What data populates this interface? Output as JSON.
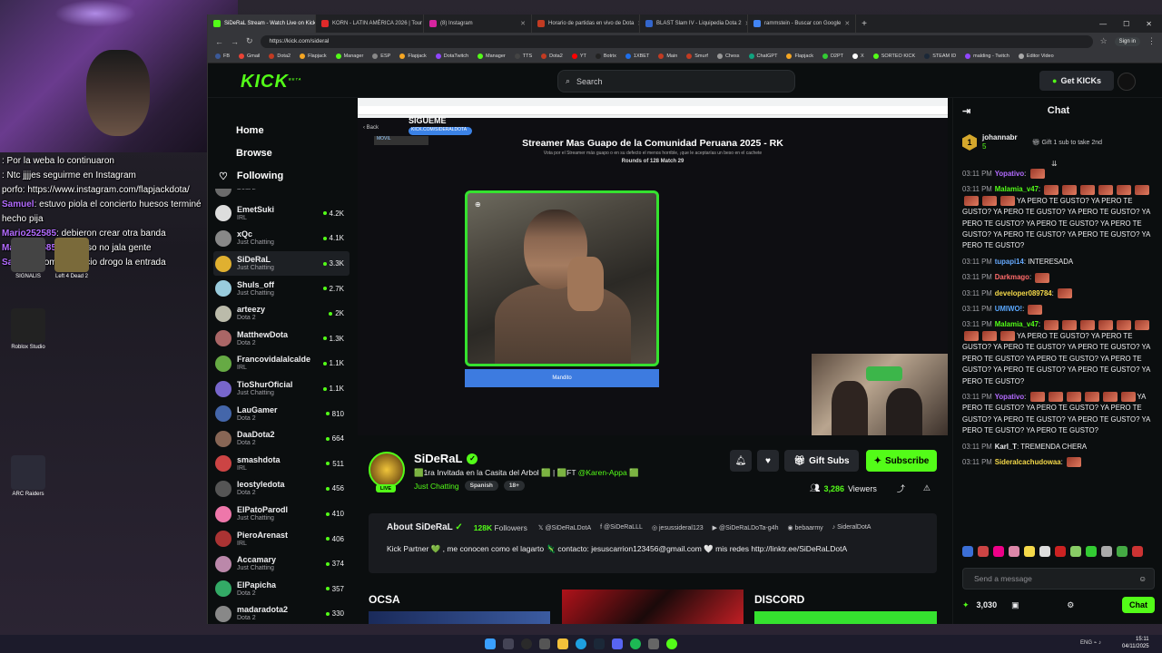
{
  "overlay_chat": [
    {
      "user": "",
      "text": ": Por la weba lo continuaron"
    },
    {
      "user": "",
      "text": ": Ntc jjjjes seguirme en Instagram"
    },
    {
      "user": "",
      "text": "porfo: https://www.instagram.com/flapjackdota/"
    },
    {
      "user": "Samuel",
      "text": ": estuvo piola el concierto huesos terminé"
    },
    {
      "user": "",
      "text": "hecho pija"
    },
    {
      "user": "Mario252585",
      "text": ": debieron crear otra banda"
    },
    {
      "user": "Mario252585",
      "text": ": pero eso no jala gente"
    },
    {
      "user": "Saru1...",
      "text": ": compre precio drogo la entrada"
    }
  ],
  "desktop_icons": [
    {
      "label": "SIGNALIS",
      "color": "#444"
    },
    {
      "label": "Left 4 Dead 2",
      "color": "#7a6a3a"
    },
    {
      "label": "Roblox Studio",
      "color": "#222"
    },
    {
      "label": "ARC Raiders",
      "color": "#2b2b38"
    }
  ],
  "browser": {
    "tabs": [
      {
        "title": "SiDeRaL Stream - Watch Live on Kick",
        "color": "#53fc18",
        "active": true
      },
      {
        "title": "KORN - LATIN AMÉRICA 2026 | Tour",
        "color": "#e02a2a",
        "active": false
      },
      {
        "title": "(8) Instagram",
        "color": "#d6249f",
        "active": false
      },
      {
        "title": "Horario de partidas en vivo de Dota",
        "color": "#c23b22",
        "active": false
      },
      {
        "title": "BLAST Slam IV - Liquipedia Dota 2",
        "color": "#3366cc",
        "active": false
      },
      {
        "title": "rammstein - Buscar con Google",
        "color": "#4285f4",
        "active": false
      }
    ],
    "new_tab": "+",
    "window_controls": [
      "—",
      "☐",
      "✕"
    ],
    "url": "https://kick.com/sideral",
    "signin": "Sign in",
    "bookmarks": [
      "FB",
      "Gmail",
      "Dota2",
      "Flapjack",
      "Manager",
      "ESP",
      "Flapjack",
      "DotaTwitch",
      "Manager",
      "TTS",
      "Dota2",
      "YT",
      "Botrix",
      "1XBET",
      "Main",
      "Smurf",
      "Chess",
      "ChatGPT",
      "Flapjack",
      "D2PT",
      "X",
      "SORTEO KICK",
      "STEAM ID",
      "malding - Twitch",
      "Editor Video"
    ]
  },
  "kick": {
    "logo": "KICK",
    "logo_sup": "BETA",
    "search_placeholder": "Search",
    "get_kicks": "Get KICKs",
    "nav": {
      "home": "Home",
      "browse": "Browse",
      "following": "Following"
    },
    "channels": [
      {
        "name": "",
        "category": "Dota 2",
        "viewers": "",
        "color": "#6b6b6b"
      },
      {
        "name": "EmetSuki",
        "category": "IRL",
        "viewers": "4.2K",
        "color": "#ddd"
      },
      {
        "name": "xQc",
        "category": "Just Chatting",
        "viewers": "4.1K",
        "color": "#888"
      },
      {
        "name": "SiDeRaL",
        "category": "Just Chatting",
        "viewers": "3.3K",
        "color": "#e0b030",
        "selected": true
      },
      {
        "name": "Shuls_off",
        "category": "Just Chatting",
        "viewers": "2.7K",
        "color": "#9cd"
      },
      {
        "name": "arteezy",
        "category": "Dota 2",
        "viewers": "2K",
        "color": "#bba"
      },
      {
        "name": "MatthewDota",
        "category": "Dota 2",
        "viewers": "1.3K",
        "color": "#a66"
      },
      {
        "name": "Francovidalalcalde",
        "category": "IRL",
        "viewers": "1.1K",
        "color": "#6a4"
      },
      {
        "name": "TioShurOficial",
        "category": "Just Chatting",
        "viewers": "1.1K",
        "color": "#76c"
      },
      {
        "name": "LauGamer",
        "category": "Dota 2",
        "viewers": "810",
        "color": "#46a"
      },
      {
        "name": "DaaDota2",
        "category": "Dota 2",
        "viewers": "664",
        "color": "#865"
      },
      {
        "name": "smashdota",
        "category": "IRL",
        "viewers": "511",
        "color": "#c44"
      },
      {
        "name": "leostyledota",
        "category": "Dota 2",
        "viewers": "456",
        "color": "#555"
      },
      {
        "name": "ElPatoParodl",
        "category": "Just Chatting",
        "viewers": "410",
        "color": "#e7a"
      },
      {
        "name": "PieroArenast",
        "category": "IRL",
        "viewers": "406",
        "color": "#a33"
      },
      {
        "name": "Accamary",
        "category": "Just Chatting",
        "viewers": "374",
        "color": "#b8a"
      },
      {
        "name": "ElPapicha",
        "category": "Dota 2",
        "viewers": "357",
        "color": "#3a6"
      },
      {
        "name": "madaradota2",
        "category": "Dota 2",
        "viewers": "330",
        "color": "#888"
      }
    ],
    "player": {
      "inner_title": "Streamer Mas Guapo de la Comunidad Peruana 2025 - RK",
      "inner_subtitle": "Vota por el Streamer más guapo o en su defecto el menos horrible, ¡que le aceptarías un beso en el cachete",
      "inner_round": "Rounds of 128 Match 29",
      "vote_button": "Mandito",
      "sigueme": "SIGUEME",
      "sigueme_handle": "KICK.COM/SIDERALDOTA",
      "back_label": "Back",
      "movil": "MOVIL"
    },
    "stream": {
      "name": "SiDeRaL",
      "live": "LIVE",
      "title_prefix": "🟩1ra Invitada en la Casita del Arbol 🟩 | 🟩FT ",
      "title_mention": "@Karen-Appa",
      "title_suffix": " 🟩",
      "category": "Just Chatting",
      "tags": [
        "Spanish",
        "18+"
      ],
      "gift_subs": "Gift Subs",
      "subscribe": "Subscribe",
      "viewers": "3,286",
      "viewers_label": "Viewers"
    },
    "about": {
      "title": "About SiDeRaL",
      "followers_count": "128K",
      "followers_label": "Followers",
      "socials": [
        "@SiDeRaLDotA",
        "@SiDeRaLLL",
        "jesussideral123",
        "@SiDeRaLDoTa-g4h",
        "bebaarmy",
        "SideralDotA"
      ],
      "bio": "Kick Partner 💚 , me conocen como el lagarto 🦎 contacto: jesuscarrion123456@gmail.com 🤍 mis redes http://linktr.ee/SiDeRaLDotA"
    },
    "panels": [
      "OCSA",
      "DISCORD"
    ],
    "chat": {
      "title": "Chat",
      "pinned_user": "johannabr",
      "pinned_count": "5",
      "pinned_rank": "1",
      "pinned_cta": "Gift 1 sub to take 2nd",
      "messages": [
        {
          "time": "03:11 PM",
          "user": "Yopativo",
          "color": "#b36bff",
          "text": "",
          "emotes": 1
        },
        {
          "time": "03:11 PM",
          "user": "Malamia_v47",
          "color": "#53fc18",
          "text": "YA PERO TE GUSTO? YA PERO TE GUSTO? YA PERO TE GUSTO? YA PERO TE GUSTO? YA PERO TE GUSTO? YA PERO TE GUSTO? YA PERO TE GUSTO? YA PERO TE GUSTO? YA PERO TE GUSTO? YA PERO TE GUSTO?",
          "emotes": 0
        },
        {
          "time": "03:11 PM",
          "user": "tupapi14",
          "color": "#66aaff",
          "text": "INTERESADA",
          "emotes": 0
        },
        {
          "time": "03:11 PM",
          "user": "Darkmago",
          "color": "#ff6b6b",
          "text": "",
          "emotes": 1
        },
        {
          "time": "03:11 PM",
          "user": "developer089784",
          "color": "#f5d94a",
          "text": "",
          "emotes": 1
        },
        {
          "time": "03:11 PM",
          "user": "UMIWO!",
          "color": "#5aa8ff",
          "text": "",
          "emotes": 1
        },
        {
          "time": "03:11 PM",
          "user": "Malamia_v47",
          "color": "#53fc18",
          "text": "YA PERO TE GUSTO? YA PERO TE GUSTO? YA PERO TE GUSTO? YA PERO TE GUSTO? YA PERO TE GUSTO? YA PERO TE GUSTO? YA PERO TE GUSTO? YA PERO TE GUSTO? YA PERO TE GUSTO? YA PERO TE GUSTO?",
          "emotes": 0
        },
        {
          "time": "03:11 PM",
          "user": "Yopativo",
          "color": "#b36bff",
          "text": "YA PERO TE GUSTO? YA PERO TE GUSTO? YA PERO TE GUSTO? YA PERO TE GUSTO? YA PERO TE GUSTO? YA PERO TE GUSTO? YA PERO TE GUSTO?",
          "emotes": 0
        },
        {
          "time": "03:11 PM",
          "user": "Karl_T",
          "color": "#efeff1",
          "text": "TREMENDA CHERA",
          "emotes": 0
        },
        {
          "time": "03:11 PM",
          "user": "Sideralcachudowaa",
          "color": "#f5d94a",
          "text": "",
          "emotes": 1
        }
      ],
      "input_placeholder": "Send a message",
      "points": "3,030",
      "send": "Chat"
    }
  },
  "taskbar": {
    "time": "15:11",
    "date": "04/11/2025",
    "lang": "ENG"
  }
}
